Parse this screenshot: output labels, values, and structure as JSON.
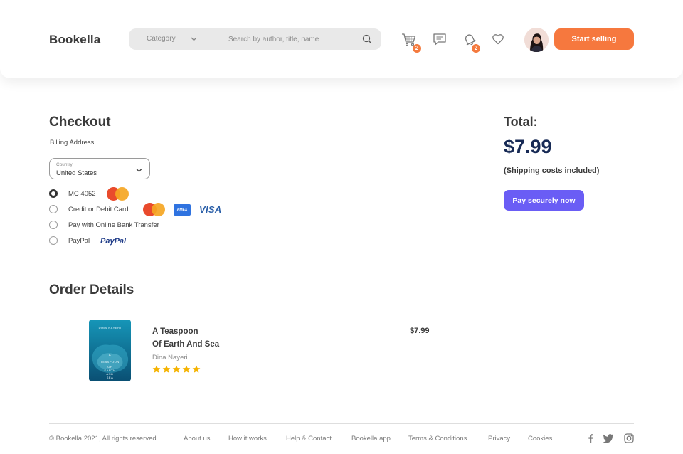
{
  "header": {
    "logo": "Bookella",
    "category_label": "Category",
    "search_placeholder": "Search by author, title, name",
    "cart_badge": "2",
    "notifications_badge": "2",
    "start_selling": "Start selling"
  },
  "checkout": {
    "title": "Checkout",
    "billing_label": "Billing Address",
    "country_label": "Country",
    "country_value": "United States",
    "payment_options": [
      {
        "label": "MC 4052",
        "selected": true
      },
      {
        "label": "Credit or Debit Card",
        "selected": false
      },
      {
        "label": "Pay with Online Bank Transfer",
        "selected": false
      },
      {
        "label": "PayPal",
        "selected": false
      }
    ],
    "logos": {
      "amex": "AMEX",
      "visa": "VISA",
      "paypal": "PayPal"
    }
  },
  "summary": {
    "total_label": "Total:",
    "total_amount": "$7.99",
    "shipping_note": "(Shipping costs included)",
    "pay_button": "Pay securely now"
  },
  "order": {
    "title": "Order Details",
    "item": {
      "title_line1": "A Teaspoon",
      "title_line2": "Of Earth And Sea",
      "author": "Dina Nayeri",
      "rating": 5,
      "price": "$7.99",
      "cover_author": "DINA NAYERI",
      "cover_title": [
        "A",
        "TEASPOON",
        "OF",
        "EARTH",
        "AND",
        "SEA"
      ]
    }
  },
  "footer": {
    "copyright": "© Bookella 2021, All rights reserved",
    "links": [
      "About us",
      "How it works",
      "Help & Contact",
      "Bookella app",
      "Terms & Conditions",
      "Privacy",
      "Cookies"
    ]
  },
  "colors": {
    "accent_orange": "#f6783e",
    "pay_purple": "#6a5df5",
    "total_navy": "#172a55",
    "star_yellow": "#f5b301"
  }
}
